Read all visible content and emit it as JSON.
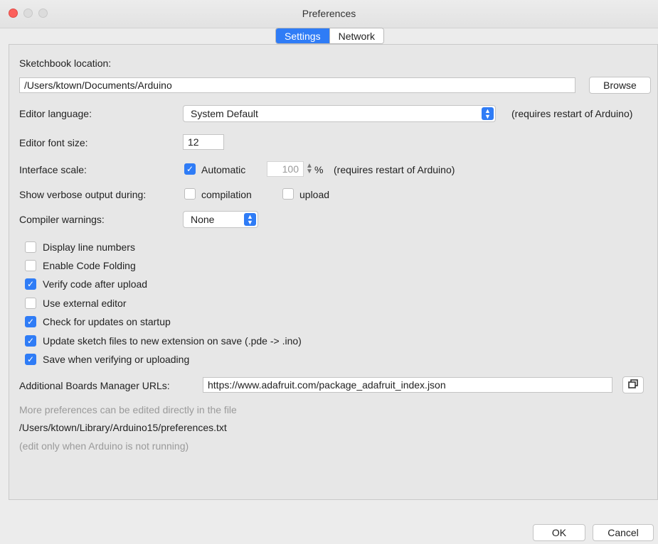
{
  "window": {
    "title": "Preferences"
  },
  "tabs": [
    {
      "label": "Settings",
      "active": true
    },
    {
      "label": "Network",
      "active": false
    }
  ],
  "sketchbook": {
    "label": "Sketchbook location:",
    "path": "/Users/ktown/Documents/Arduino",
    "browse_label": "Browse"
  },
  "editor_language": {
    "label": "Editor language:",
    "value": "System Default",
    "note": "(requires restart of Arduino)"
  },
  "font_size": {
    "label": "Editor font size:",
    "value": "12"
  },
  "interface_scale": {
    "label": "Interface scale:",
    "automatic_label": "Automatic",
    "automatic_checked": true,
    "value": "100",
    "percent": "%",
    "note": "(requires restart of Arduino)"
  },
  "verbose": {
    "label": "Show verbose output during:",
    "compilation_label": "compilation",
    "compilation_checked": false,
    "upload_label": "upload",
    "upload_checked": false
  },
  "compiler_warnings": {
    "label": "Compiler warnings:",
    "value": "None"
  },
  "options": [
    {
      "label": "Display line numbers",
      "checked": false
    },
    {
      "label": "Enable Code Folding",
      "checked": false
    },
    {
      "label": "Verify code after upload",
      "checked": true
    },
    {
      "label": "Use external editor",
      "checked": false
    },
    {
      "label": "Check for updates on startup",
      "checked": true
    },
    {
      "label": "Update sketch files to new extension on save (.pde -> .ino)",
      "checked": true
    },
    {
      "label": "Save when verifying or uploading",
      "checked": true
    }
  ],
  "boards_urls": {
    "label": "Additional Boards Manager URLs:",
    "value": "https://www.adafruit.com/package_adafruit_index.json"
  },
  "footer_info": {
    "line1": "More preferences can be edited directly in the file",
    "path": "/Users/ktown/Library/Arduino15/preferences.txt",
    "line3": "(edit only when Arduino is not running)"
  },
  "buttons": {
    "ok": "OK",
    "cancel": "Cancel"
  },
  "colors": {
    "accent": "#2f7cf6",
    "close": "#fc605c",
    "panel_bg": "#e7e7e7"
  }
}
